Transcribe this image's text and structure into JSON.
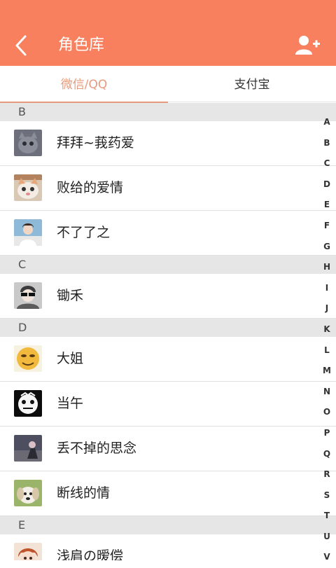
{
  "header": {
    "title": "角色库",
    "back_icon": "chevron-left-icon",
    "add_icon": "add-user-icon",
    "background": "#f9805e"
  },
  "tabs": [
    {
      "label": "微信/QQ",
      "active": true
    },
    {
      "label": "支付宝",
      "active": false
    }
  ],
  "sections": [
    {
      "letter": "B",
      "contacts": [
        {
          "name": "拜拜~莪药爱"
        },
        {
          "name": "败给的爱情"
        },
        {
          "name": "不了了之"
        }
      ]
    },
    {
      "letter": "C",
      "contacts": [
        {
          "name": "锄禾"
        }
      ]
    },
    {
      "letter": "D",
      "contacts": [
        {
          "name": "大姐"
        },
        {
          "name": "当午"
        },
        {
          "name": "丢不掉的思念"
        },
        {
          "name": "断线的情"
        }
      ]
    },
    {
      "letter": "E",
      "contacts": [
        {
          "name": "浅肩の暧偿"
        }
      ]
    }
  ],
  "index_letters": [
    "A",
    "B",
    "C",
    "D",
    "E",
    "F",
    "G",
    "H",
    "I",
    "J",
    "K",
    "L",
    "M",
    "N",
    "O",
    "P",
    "Q",
    "R",
    "S",
    "T",
    "U",
    "V"
  ],
  "accent_color": "#e69a7d"
}
